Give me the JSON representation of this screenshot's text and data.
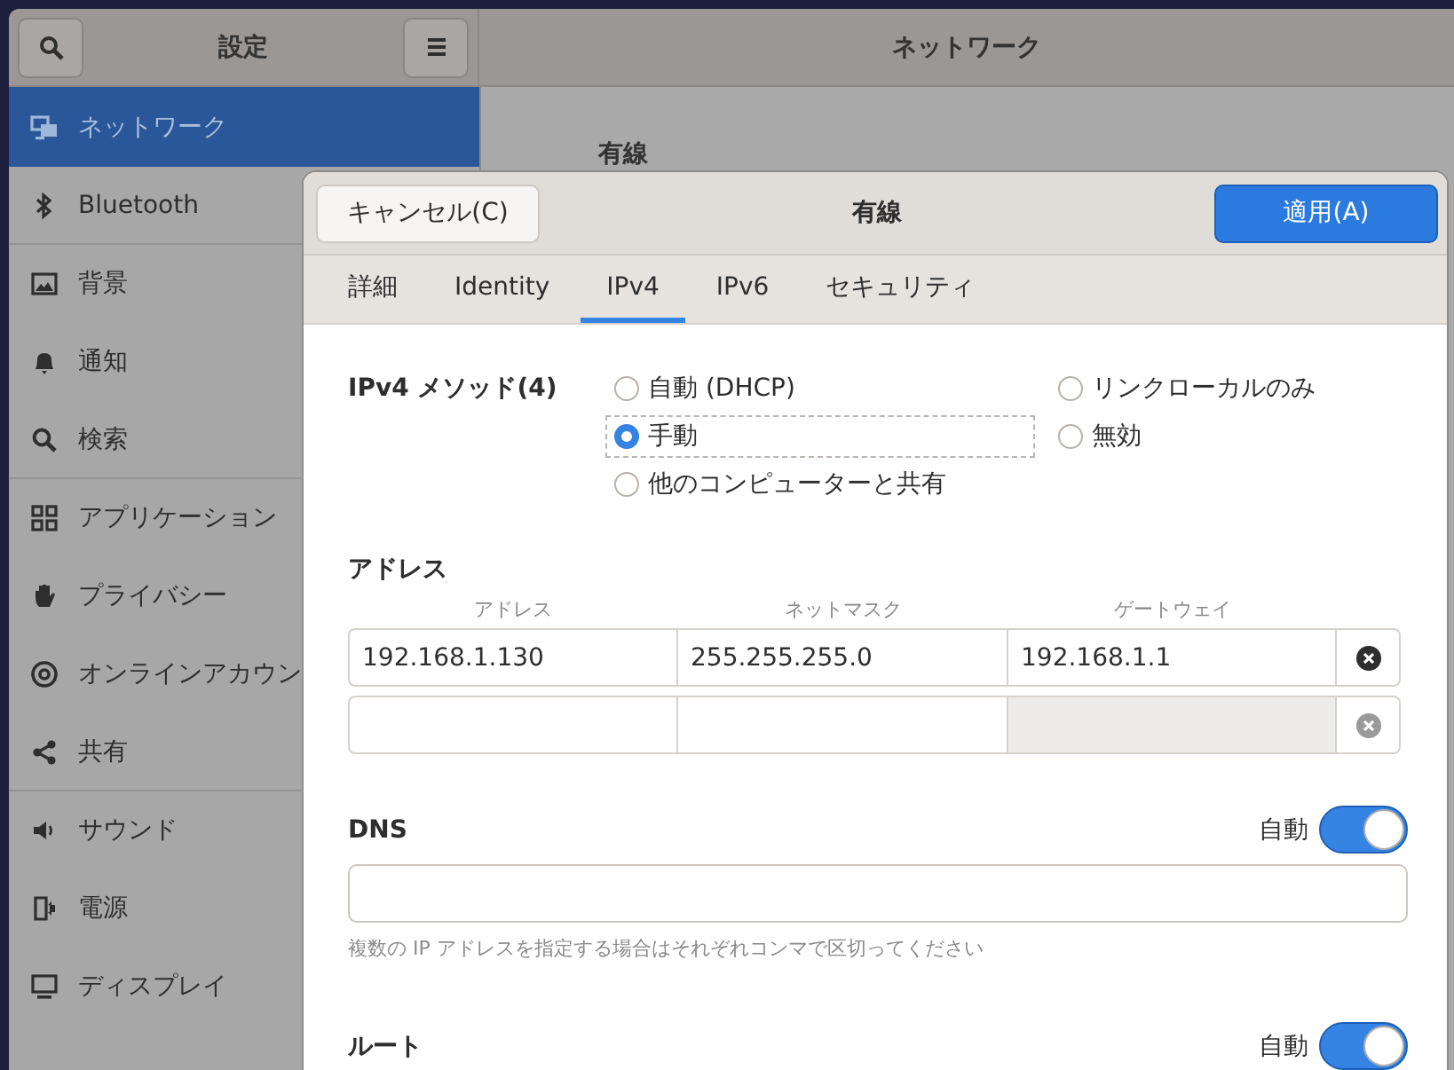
{
  "settings": {
    "title": "設定",
    "panel_title": "ネットワーク",
    "section_title": "有線",
    "sidebar": [
      {
        "label": "ネットワーク",
        "selected": true,
        "divider_after": false
      },
      {
        "label": "Bluetooth",
        "selected": false,
        "divider_after": true
      },
      {
        "label": "背景",
        "selected": false,
        "divider_after": false
      },
      {
        "label": "通知",
        "selected": false,
        "divider_after": false
      },
      {
        "label": "検索",
        "selected": false,
        "divider_after": true
      },
      {
        "label": "アプリケーション",
        "selected": false,
        "divider_after": false
      },
      {
        "label": "プライバシー",
        "selected": false,
        "divider_after": false
      },
      {
        "label": "オンラインアカウン",
        "selected": false,
        "divider_after": false
      },
      {
        "label": "共有",
        "selected": false,
        "divider_after": true
      },
      {
        "label": "サウンド",
        "selected": false,
        "divider_after": false
      },
      {
        "label": "電源",
        "selected": false,
        "divider_after": false
      },
      {
        "label": "ディスプレイ",
        "selected": false,
        "divider_after": false
      }
    ]
  },
  "dialog": {
    "title": "有線",
    "cancel_button": "キャンセル(C)",
    "apply_button": "適用(A)",
    "tabs": [
      {
        "label": "詳細",
        "selected": false
      },
      {
        "label": "Identity",
        "selected": false
      },
      {
        "label": "IPv4",
        "selected": true
      },
      {
        "label": "IPv6",
        "selected": false
      },
      {
        "label": "セキュリティ",
        "selected": false
      }
    ],
    "method_label": "IPv4 メソッド(4)",
    "methods": [
      {
        "label": "自動 (DHCP)",
        "selected": false
      },
      {
        "label": "手動",
        "selected": true
      },
      {
        "label": "他のコンピューターと共有",
        "selected": false
      },
      {
        "label": "リンクローカルのみ",
        "selected": false
      },
      {
        "label": "無効",
        "selected": false
      }
    ],
    "addresses": {
      "heading": "アドレス",
      "columns": [
        "アドレス",
        "ネットマスク",
        "ゲートウェイ"
      ],
      "rows": [
        {
          "address": "192.168.1.130",
          "netmask": "255.255.255.0",
          "gateway": "192.168.1.1",
          "gateway_disabled": false,
          "removable": true
        },
        {
          "gateway_disabled": true,
          "removable": false
        }
      ]
    },
    "dns": {
      "label": "DNS",
      "auto_label": "自動",
      "auto": true,
      "hint": "複数の IP アドレスを指定する場合はそれぞれコンマで区切ってください"
    },
    "routes": {
      "label": "ルート",
      "auto_label": "自動",
      "auto": true
    }
  }
}
